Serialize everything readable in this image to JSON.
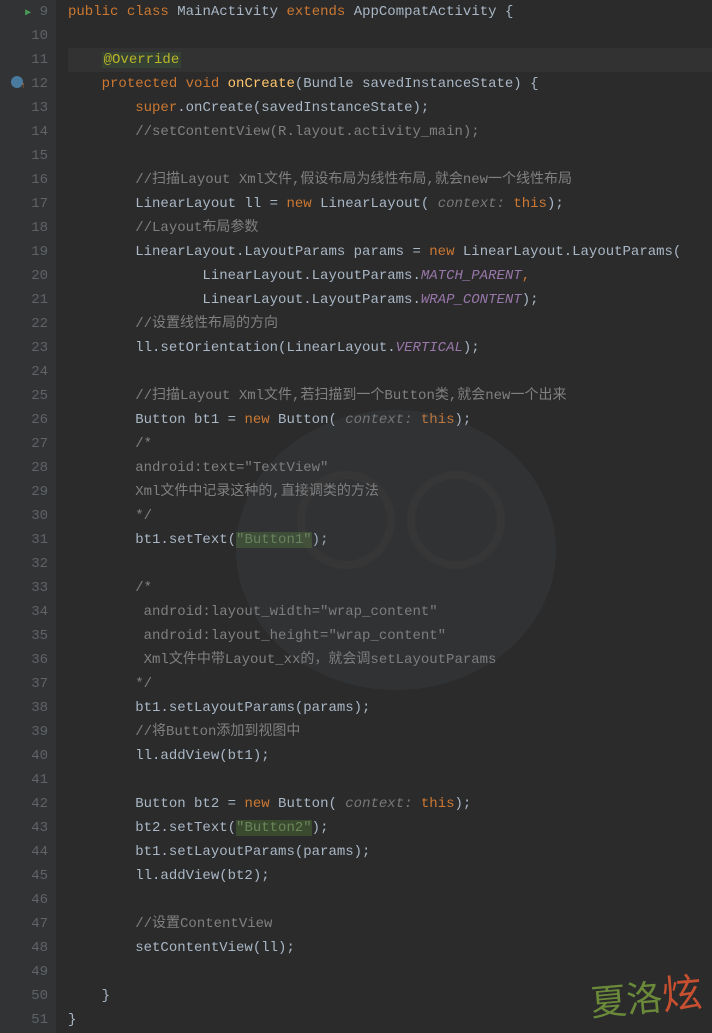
{
  "lines": {
    "9": {
      "num": "9"
    },
    "10": {
      "num": "10"
    },
    "11": {
      "num": "11"
    },
    "12": {
      "num": "12"
    },
    "13": {
      "num": "13"
    },
    "14": {
      "num": "14"
    },
    "15": {
      "num": "15"
    },
    "16": {
      "num": "16"
    },
    "17": {
      "num": "17"
    },
    "18": {
      "num": "18"
    },
    "19": {
      "num": "19"
    },
    "20": {
      "num": "20"
    },
    "21": {
      "num": "21"
    },
    "22": {
      "num": "22"
    },
    "23": {
      "num": "23"
    },
    "24": {
      "num": "24"
    },
    "25": {
      "num": "25"
    },
    "26": {
      "num": "26"
    },
    "27": {
      "num": "27"
    },
    "28": {
      "num": "28"
    },
    "29": {
      "num": "29"
    },
    "30": {
      "num": "30"
    },
    "31": {
      "num": "31"
    },
    "32": {
      "num": "32"
    },
    "33": {
      "num": "33"
    },
    "34": {
      "num": "34"
    },
    "35": {
      "num": "35"
    },
    "36": {
      "num": "36"
    },
    "37": {
      "num": "37"
    },
    "38": {
      "num": "38"
    },
    "39": {
      "num": "39"
    },
    "40": {
      "num": "40"
    },
    "41": {
      "num": "41"
    },
    "42": {
      "num": "42"
    },
    "43": {
      "num": "43"
    },
    "44": {
      "num": "44"
    },
    "45": {
      "num": "45"
    },
    "46": {
      "num": "46"
    },
    "47": {
      "num": "47"
    },
    "48": {
      "num": "48"
    },
    "49": {
      "num": "49"
    },
    "50": {
      "num": "50"
    },
    "51": {
      "num": "51"
    }
  },
  "code": {
    "l9": {
      "public": "public",
      "class": "class",
      "MainActivity": "MainActivity",
      "extends": "extends",
      "AppCompatActivity": "AppCompatActivity",
      "brace": "{"
    },
    "l11": {
      "annotation": "@Override"
    },
    "l12": {
      "protected": "protected",
      "void": "void",
      "onCreate": "onCreate",
      "Bundle": "(Bundle savedInstanceState) {"
    },
    "l13": {
      "super": "super",
      "rest": ".onCreate(savedInstanceState);"
    },
    "l14": {
      "comment": "//setContentView(R.layout.activity_main);"
    },
    "l16": {
      "comment": "//扫描Layout Xml文件,假设布局为线性布局,就会new一个线性布局"
    },
    "l17": {
      "decl": "LinearLayout ll = ",
      "new": "new",
      "ctor": "LinearLayout( ",
      "hint": "context: ",
      "this": "this",
      "end": ");"
    },
    "l18": {
      "comment": "//Layout布局参数"
    },
    "l19": {
      "decl": "LinearLayout.LayoutParams params = ",
      "new": "new",
      "ctor": " LinearLayout.LayoutParams("
    },
    "l20": {
      "prefix": "LinearLayout.LayoutParams.",
      "field": "MATCH_PARENT",
      "comma": ","
    },
    "l21": {
      "prefix": "LinearLayout.LayoutParams.",
      "field": "WRAP_CONTENT",
      "end": ");"
    },
    "l22": {
      "comment": "//设置线性布局的方向"
    },
    "l23": {
      "call": "ll.setOrientation(LinearLayout.",
      "field": "VERTICAL",
      "end": ");"
    },
    "l25": {
      "comment": "//扫描Layout Xml文件,若扫描到一个Button类,就会new一个出来"
    },
    "l26": {
      "decl": "Button bt1 = ",
      "new": "new",
      "ctor": " Button( ",
      "hint": "context: ",
      "this": "this",
      "end": ");"
    },
    "l27": {
      "comment": "/*"
    },
    "l28": {
      "comment": "android:text=\"TextView\""
    },
    "l29": {
      "comment": "Xml文件中记录这种的,直接调类的方法"
    },
    "l30": {
      "comment": "*/"
    },
    "l31": {
      "call": "bt1.setText(",
      "str": "\"Button1\"",
      "end": ");"
    },
    "l33": {
      "comment": "/*"
    },
    "l34": {
      "comment": " android:layout_width=\"wrap_content\""
    },
    "l35": {
      "comment": " android:layout_height=\"wrap_content\""
    },
    "l36": {
      "comment": " Xml文件中带Layout_xx的，就会调setLayoutParams"
    },
    "l37": {
      "comment": "*/"
    },
    "l38": {
      "call": "bt1.setLayoutParams(params);"
    },
    "l39": {
      "comment": "//将Button添加到视图中"
    },
    "l40": {
      "call": "ll.addView(bt1);"
    },
    "l42": {
      "decl": "Button bt2 = ",
      "new": "new",
      "ctor": " Button( ",
      "hint": "context: ",
      "this": "this",
      "end": ");"
    },
    "l43": {
      "call": "bt2.setText(",
      "str": "\"Button2\"",
      "end": ");"
    },
    "l44": {
      "call": "bt1.setLayoutParams(params);"
    },
    "l45": {
      "call": "ll.addView(bt2);"
    },
    "l47": {
      "comment": "//设置ContentView"
    },
    "l48": {
      "call": "setContentView(ll);"
    },
    "l50": {
      "brace": "}"
    },
    "l51": {
      "brace": "}"
    }
  }
}
